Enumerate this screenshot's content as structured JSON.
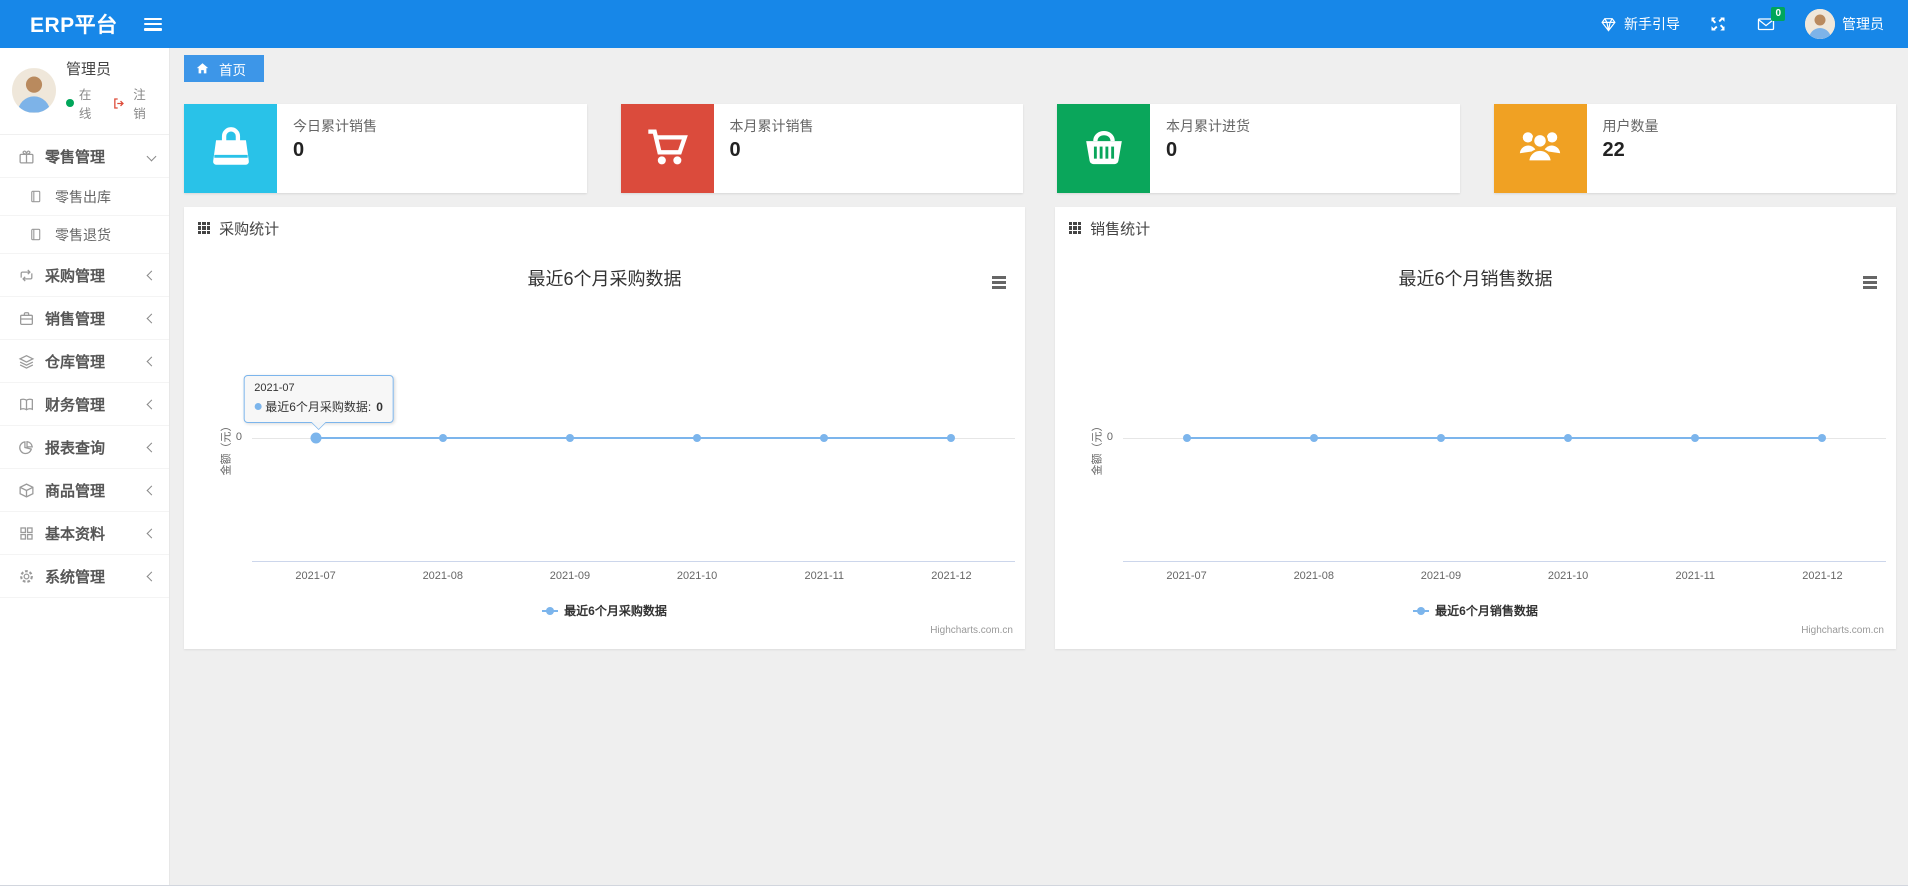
{
  "navbar": {
    "brand": "ERP平台",
    "guide_label": "新手引导",
    "message_badge": "0",
    "username": "管理员"
  },
  "sidebar": {
    "user": {
      "name": "管理员",
      "status": "在线",
      "logout": "注销"
    },
    "items": [
      {
        "label": "零售管理",
        "icon": "gift-icon",
        "state": "expanded",
        "children": [
          {
            "label": "零售出库",
            "icon": "notebook-icon"
          },
          {
            "label": "零售退货",
            "icon": "notebook-icon"
          }
        ]
      },
      {
        "label": "采购管理",
        "icon": "exchange-icon",
        "state": "collapsed"
      },
      {
        "label": "销售管理",
        "icon": "briefcase-icon",
        "state": "collapsed"
      },
      {
        "label": "仓库管理",
        "icon": "layers-icon",
        "state": "collapsed"
      },
      {
        "label": "财务管理",
        "icon": "book-open-icon",
        "state": "collapsed"
      },
      {
        "label": "报表查询",
        "icon": "pie-chart-icon",
        "state": "collapsed"
      },
      {
        "label": "商品管理",
        "icon": "package-icon",
        "state": "collapsed"
      },
      {
        "label": "基本资料",
        "icon": "grid-icon",
        "state": "collapsed"
      },
      {
        "label": "系统管理",
        "icon": "gear-icon",
        "state": "collapsed"
      }
    ]
  },
  "tabs": [
    {
      "label": "首页",
      "icon": "home-icon",
      "active": true
    }
  ],
  "stat_cards": [
    {
      "label": "今日累计销售",
      "value": "0",
      "icon": "shopping-bag-icon",
      "color": "#29c2e8"
    },
    {
      "label": "本月累计销售",
      "value": "0",
      "icon": "cart-icon",
      "color": "#db4b3c"
    },
    {
      "label": "本月累计进货",
      "value": "0",
      "icon": "basket-icon",
      "color": "#0aa65b"
    },
    {
      "label": "用户数量",
      "value": "22",
      "icon": "users-icon",
      "color": "#f0a123"
    }
  ],
  "panels": [
    {
      "title": "采购统计"
    },
    {
      "title": "销售统计"
    }
  ],
  "chart_data": [
    {
      "type": "line",
      "title": "最近6个月采购数据",
      "categories": [
        "2021-07",
        "2021-08",
        "2021-09",
        "2021-10",
        "2021-11",
        "2021-12"
      ],
      "series": [
        {
          "name": "最近6个月采购数据",
          "values": [
            0,
            0,
            0,
            0,
            0,
            0
          ]
        }
      ],
      "xlabel": "",
      "ylabel": "金额（元）",
      "yticks": [
        "0"
      ],
      "grid": false,
      "legend_position": "bottom",
      "line_color": "#7cb5ec",
      "credits": "Highcharts.com.cn",
      "tooltip": {
        "header": "2021-07",
        "series_label": "最近6个月采购数据:",
        "value": "0",
        "point_index": 0
      }
    },
    {
      "type": "line",
      "title": "最近6个月销售数据",
      "categories": [
        "2021-07",
        "2021-08",
        "2021-09",
        "2021-10",
        "2021-11",
        "2021-12"
      ],
      "series": [
        {
          "name": "最近6个月销售数据",
          "values": [
            0,
            0,
            0,
            0,
            0,
            0
          ]
        }
      ],
      "xlabel": "",
      "ylabel": "金额（元）",
      "yticks": [
        "0"
      ],
      "grid": false,
      "legend_position": "bottom",
      "line_color": "#7cb5ec",
      "credits": "Highcharts.com.cn"
    }
  ],
  "colors": {
    "navbar_bg": "#1787e8",
    "active_tab_bg": "#3d96e8",
    "card_cyan": "#29c2e8",
    "card_red": "#db4b3c",
    "card_green": "#0aa65b",
    "card_orange": "#f0a123",
    "chart_line": "#7cb5ec",
    "badge_green": "#00a65a",
    "online_green": "#00a65a",
    "logout_red": "#dd4b39"
  }
}
